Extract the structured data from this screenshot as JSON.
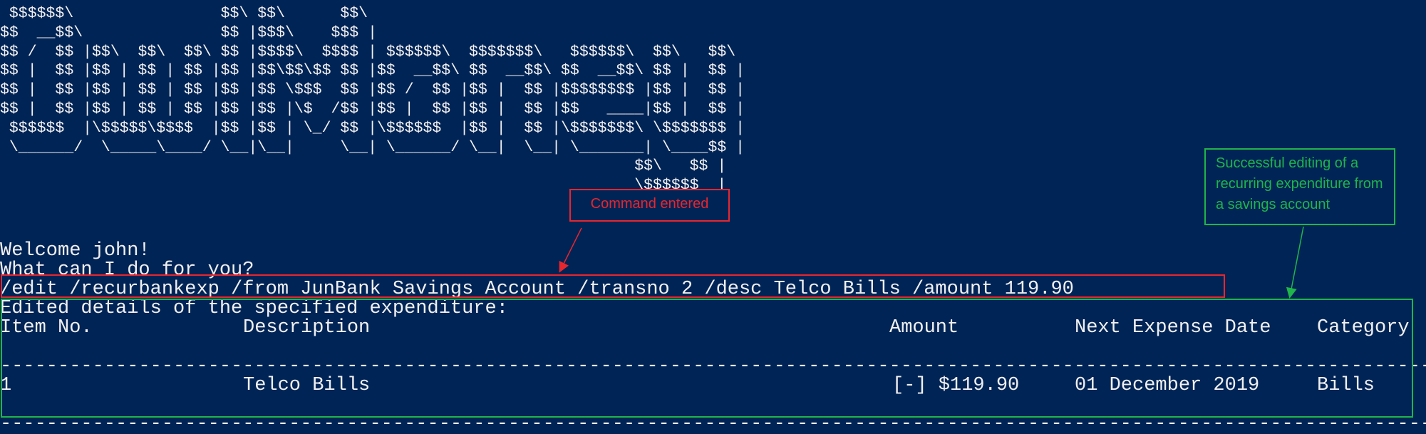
{
  "terminal": {
    "banner_art": " $$$$$$\\                $$\\ $$\\      $$\\\n$$  __$$\\               $$ |$$$\\    $$$ |\n$$ /  $$ |$$\\  $$\\  $$\\ $$ |$$$$\\  $$$$ | $$$$$$\\  $$$$$$$\\   $$$$$$\\  $$\\   $$\\\n$$ |  $$ |$$ | $$ | $$ |$$ |$$\\$$\\$$ $$ |$$  __$$\\ $$  __$$\\ $$  __$$\\ $$ |  $$ |\n$$ |  $$ |$$ | $$ | $$ |$$ |$$ \\$$$  $$ |$$ /  $$ |$$ |  $$ |$$$$$$$$ |$$ |  $$ |\n$$ |  $$ |$$ | $$ | $$ |$$ |$$ |\\$  /$$ |$$ |  $$ |$$ |  $$ |$$   ____|$$ |  $$ |\n $$$$$$  |\\$$$$$\\$$$$  |$$ |$$ | \\_/ $$ |\\$$$$$$  |$$ |  $$ |\\$$$$$$$\\ \\$$$$$$$ |\n \\______/  \\_____\\____/ \\__|\\__|     \\__| \\______/ \\__|  \\__| \\_______| \\____$$ |\n                                                                     $$\\   $$ |\n                                                                     \\$$$$$$  |\n                                                                      \\______/",
    "welcome": "Welcome john!",
    "prompt": "What can I do for you?",
    "command": "/edit /recurbankexp /from JunBank Savings Account /transno 2 /desc Telco Bills /amount 119.90",
    "result_heading": "Edited details of the specified expenditure:",
    "table": {
      "headers": [
        "Item No.",
        "Description",
        "Amount",
        "Next Expense Date",
        "Category"
      ],
      "rows": [
        [
          "1",
          "Telco Bills",
          "[-] $119.90",
          "01 December 2019",
          "Bills"
        ]
      ],
      "separator": "----------------------------------------------------------------------------------------------------------------------------------------------------------------"
    }
  },
  "annotations": {
    "command": {
      "label": "Command entered",
      "color": "#e8262d"
    },
    "result": {
      "label": "Successful editing of a recurring expenditure from a savings account",
      "color": "#1fb54a"
    }
  },
  "colors": {
    "background": "#012456",
    "text": "#f0f0f0"
  }
}
